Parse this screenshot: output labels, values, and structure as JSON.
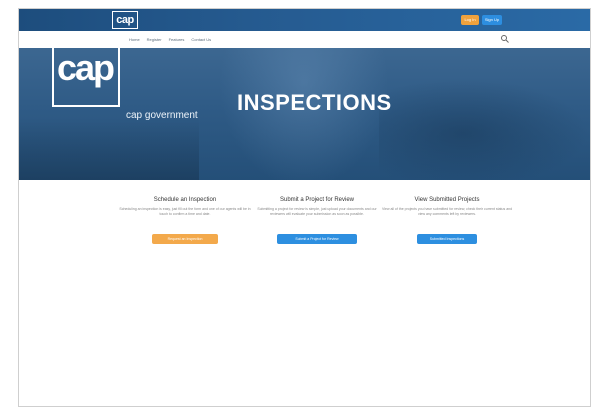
{
  "header": {
    "logo": "cap",
    "login_label": "Log In",
    "signup_label": "Sign Up"
  },
  "nav": {
    "links": [
      "Home",
      "Register",
      "Features",
      "Contact Us"
    ]
  },
  "hero": {
    "logo": "cap",
    "tagline": "cap government",
    "title": "INSPECTIONS"
  },
  "cards": [
    {
      "title": "Schedule an Inspection",
      "desc": "Scheduling an inspection is easy, just fill out the form and one of our agents will be in touch to confirm a time and date.",
      "button": "Request an Inspection"
    },
    {
      "title": "Submit a Project for Review",
      "desc": "Submitting a project for review is simple, just upload your documents and our reviewers will evaluate your submission as soon as possible.",
      "button": "Submit a Project for Review"
    },
    {
      "title": "View Submitted Projects",
      "desc": "View all of the projects you have submitted for review, check their current status and view any comments left by reviewers.",
      "button": "Submitted Inspections"
    }
  ],
  "colors": {
    "brand_blue": "#2a6aa6",
    "accent_orange": "#f3a94b",
    "button_blue": "#2d8fe0"
  }
}
